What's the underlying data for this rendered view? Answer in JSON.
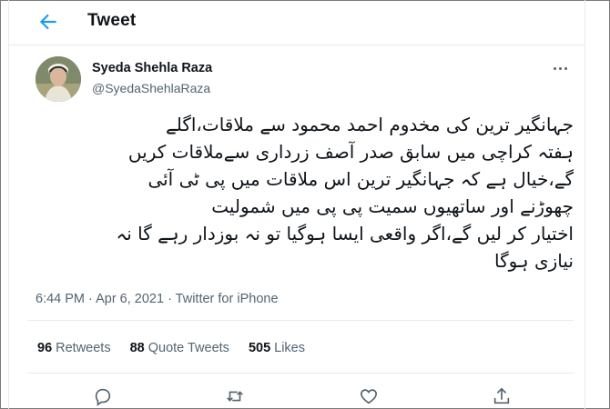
{
  "header": {
    "back_icon": "back-arrow-icon",
    "title": "Tweet"
  },
  "author": {
    "name": "Syeda Shehla Raza",
    "handle": "@SyedaShehlaRaza"
  },
  "tweet": {
    "text": "جہانگیر ترین کی مخدوم احمد محمود سے ملاقات،اگلے\nہفتہ کراچی میں سابق صدر آصف زرداری سےملاقات کریں\nگے،خیال ہے کہ جہانگیر ترین اس ملاقات میں پی ٹی آئی\nچھوڑنے اور ساتھیوں سمیت پی پی میں شمولیت\nاختیار کر لیں گے،اگر واقعی ایسا ہوگیا تو نہ بوزدار رہے گا نہ\nنیازی ہوگا",
    "meta": "6:44 PM · Apr 6, 2021 · Twitter for iPhone"
  },
  "stats": {
    "retweets_count": "96",
    "retweets_label": "Retweets",
    "quotes_count": "88",
    "quotes_label": "Quote Tweets",
    "likes_count": "505",
    "likes_label": "Likes"
  },
  "actions": [
    "reply-icon",
    "retweet-icon",
    "like-icon",
    "share-icon"
  ],
  "colors": {
    "accent": "#1d9bf0",
    "text": "#0f1419",
    "secondary": "#536471",
    "border": "#e6ecf0"
  }
}
